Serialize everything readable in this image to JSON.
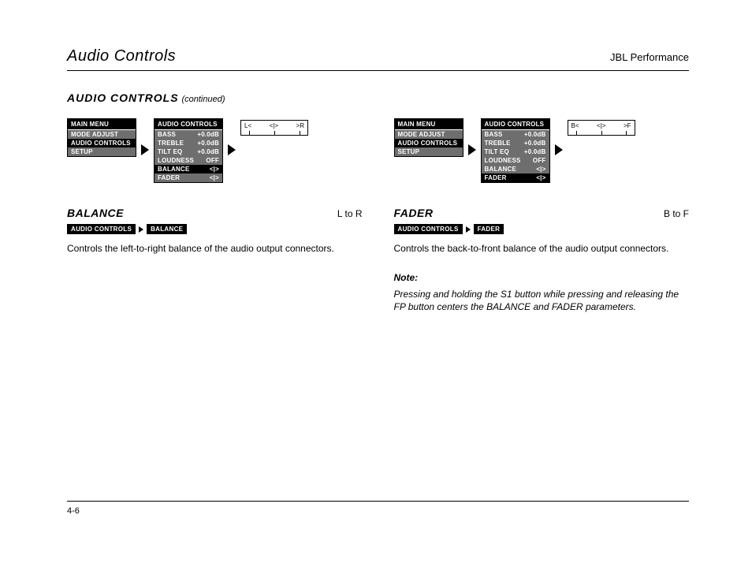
{
  "header": {
    "left": "Audio Controls",
    "right": "JBL Performance"
  },
  "section": {
    "title": "AUDIO CONTROLS",
    "cont": "(continued)"
  },
  "balance": {
    "menu": {
      "header": "MAIN MENU",
      "items": [
        "MODE ADJUST",
        "AUDIO CONTROLS",
        "SETUP"
      ],
      "selected": "AUDIO CONTROLS"
    },
    "submenu": {
      "header": "AUDIO CONTROLS",
      "rows": [
        {
          "k": "BASS",
          "v": "+0.0dB"
        },
        {
          "k": "TREBLE",
          "v": "+0.0dB"
        },
        {
          "k": "TILT EQ",
          "v": "+0.0dB"
        },
        {
          "k": "LOUDNESS",
          "v": "OFF"
        },
        {
          "k": "BALANCE",
          "v": "<|>"
        },
        {
          "k": "FADER",
          "v": "<|>"
        }
      ],
      "selected": "BALANCE"
    },
    "scale": {
      "left": "L<",
      "center": "<|>",
      "right": ">R"
    },
    "heading": "BALANCE",
    "range": "L to R",
    "crumbs": [
      "AUDIO CONTROLS",
      "BALANCE"
    ],
    "text": "Controls the left-to-right balance of the audio output connectors."
  },
  "fader": {
    "menu": {
      "header": "MAIN MENU",
      "items": [
        "MODE ADJUST",
        "AUDIO CONTROLS",
        "SETUP"
      ],
      "selected": "AUDIO CONTROLS"
    },
    "submenu": {
      "header": "AUDIO CONTROLS",
      "rows": [
        {
          "k": "BASS",
          "v": "+0.0dB"
        },
        {
          "k": "TREBLE",
          "v": "+0.0dB"
        },
        {
          "k": "TILT EQ",
          "v": "+0.0dB"
        },
        {
          "k": "LOUDNESS",
          "v": "OFF"
        },
        {
          "k": "BALANCE",
          "v": "<|>"
        },
        {
          "k": "FADER",
          "v": "<|>"
        }
      ],
      "selected": "FADER"
    },
    "scale": {
      "left": "B<",
      "center": "<|>",
      "right": ">F"
    },
    "heading": "FADER",
    "range": "B to F",
    "crumbs": [
      "AUDIO CONTROLS",
      "FADER"
    ],
    "text": "Controls the back-to-front balance of the audio output connectors.",
    "note_label": "Note:",
    "note_text": "Pressing and holding the S1 button while pressing and releasing the FP button centers the BALANCE and FADER parameters."
  },
  "page_number": "4-6"
}
